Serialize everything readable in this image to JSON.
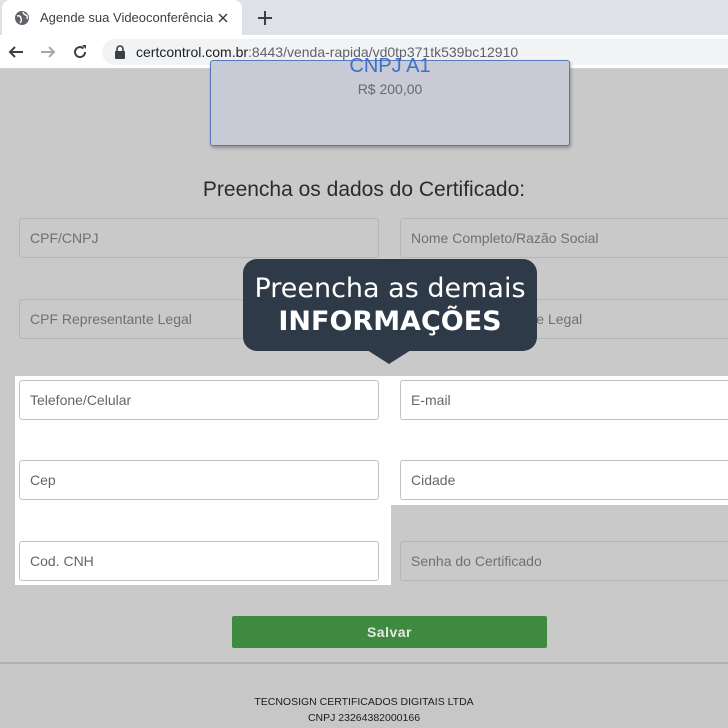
{
  "browser": {
    "tab_title": "Agende sua Videoconferência",
    "url_host": "certcontrol.com.br",
    "url_rest": ":8443/venda-rapida/vd0tp371tk539bc12910"
  },
  "product": {
    "name": "CNPJ A1",
    "price": "R$ 200,00"
  },
  "form": {
    "title": "Preencha os dados do Certificado:",
    "cpf_cnpj": "CPF/CNPJ",
    "nome": "Nome Completo/Razão Social",
    "cpf_representante": "CPF Representante Legal",
    "representante_right": "Nome Representante Legal",
    "telefone": "Telefone/Celular",
    "email": "E-mail",
    "cep": "Cep",
    "cidade": "Cidade",
    "cnh": "Cod. CNH",
    "senha": "Senha do Certificado",
    "save_label": "Salvar"
  },
  "tooltip": {
    "line1": "Preencha as demais",
    "line2": "INFORMAÇÕES"
  },
  "footer": {
    "company": "TECNOSIGN CERTIFICADOS DIGITAIS LTDA",
    "cnpj": "CNPJ 23264382000166"
  },
  "colors": {
    "save_button": "#3e8a3f",
    "tooltip_bg": "#2f3a48",
    "product_name": "#3d72c4"
  }
}
